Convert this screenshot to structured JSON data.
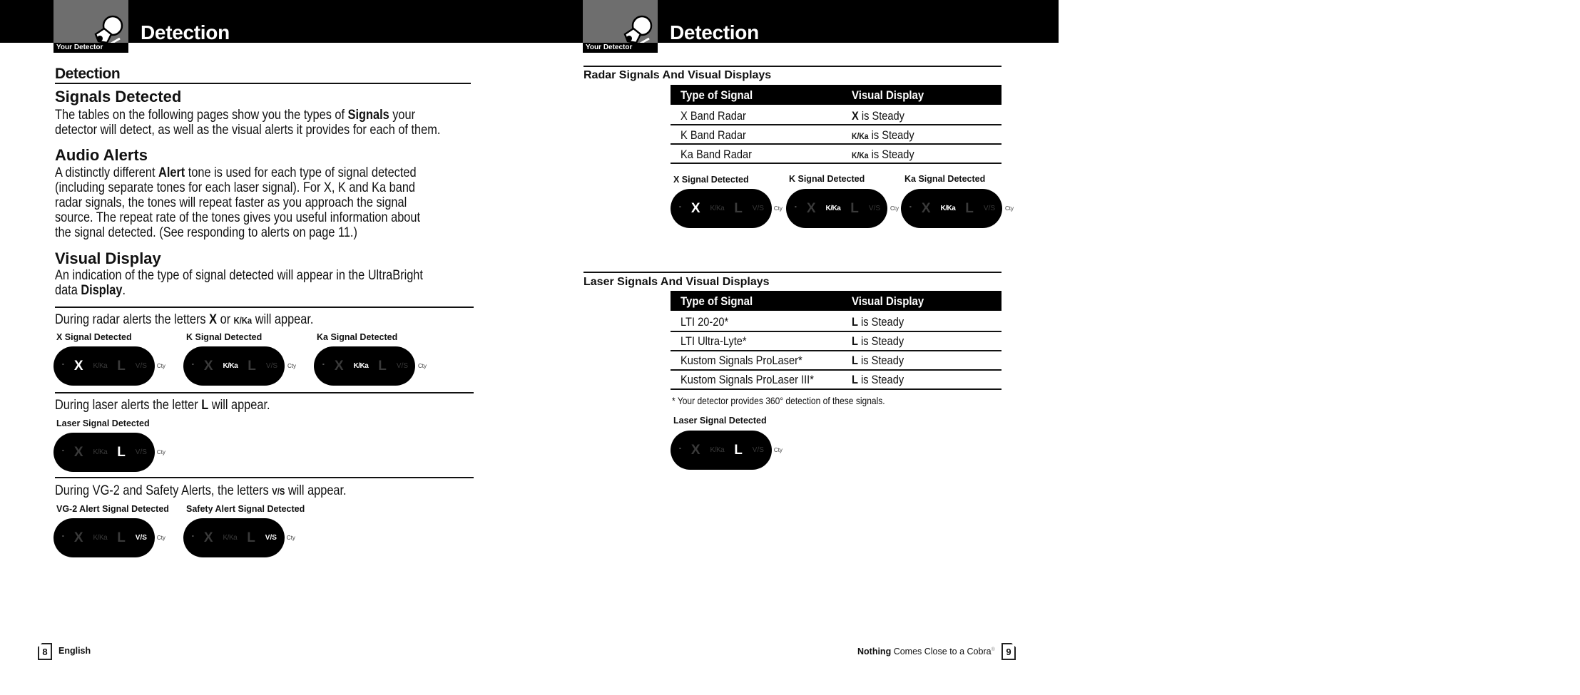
{
  "header": {
    "section_tag": "Your Detector",
    "title": "Detection",
    "icon": "radar-detector-icon"
  },
  "left_page": {
    "heading": "Detection",
    "signals": {
      "title": "Signals Detected",
      "lines": [
        {
          "pre": "The tables on the following pages show you the types of ",
          "bold": "Signals",
          "post": " your"
        },
        {
          "pre": "detector will detect, as well as the visual alerts it provides for each of them.",
          "bold": "",
          "post": ""
        }
      ]
    },
    "audio": {
      "title": "Audio Alerts",
      "lines": [
        {
          "pre": "A distinctly different ",
          "bold": "Alert",
          "post": " tone is used for each type of signal detected"
        },
        {
          "pre": "(including separate tones for each laser signal). For X, K and Ka band",
          "bold": "",
          "post": ""
        },
        {
          "pre": "radar signals, the tones will repeat faster as you approach the signal",
          "bold": "",
          "post": ""
        },
        {
          "pre": "source. The repeat rate of the tones gives you useful information about",
          "bold": "",
          "post": ""
        },
        {
          "pre": "the signal detected. (See responding to alerts on page 11.)",
          "bold": "",
          "post": ""
        }
      ]
    },
    "visual": {
      "title": "Visual Display",
      "lines": [
        {
          "pre": "An indication of the type of signal detected will appear in the UltraBright",
          "bold": "",
          "post": ""
        },
        {
          "pre": "data ",
          "bold": "Display",
          "post": "."
        }
      ]
    },
    "radar_section": {
      "lead_pre": "During radar alerts the letters ",
      "lead_bold1": "X",
      "lead_mid": " or ",
      "lead_bold2": "K/Ka",
      "lead_post": " will appear.",
      "displays": [
        {
          "label": "X Signal Detected",
          "active": "X"
        },
        {
          "label": "K Signal Detected",
          "active": "K/Ka"
        },
        {
          "label": "Ka Signal Detected",
          "active": "K/Ka"
        }
      ]
    },
    "laser_section": {
      "lead_pre": "During laser alerts the letter ",
      "lead_bold": "L",
      "lead_post": " will appear.",
      "displays": [
        {
          "label": "Laser Signal Detected",
          "active": "L"
        }
      ]
    },
    "vg2_section": {
      "lead_pre": "During VG-2 and Safety Alerts, the letters ",
      "lead_bold": "V/S",
      "lead_post": " will appear.",
      "displays": [
        {
          "label": "VG-2 Alert Signal Detected",
          "active": "V/S"
        },
        {
          "label": "Safety Alert Signal Detected",
          "active": "V/S"
        }
      ]
    },
    "footer": {
      "page_number": "8",
      "text": "English"
    }
  },
  "display_glyphs": {
    "dot": "°",
    "x": "X",
    "k": "K/Ka",
    "l": "L",
    "vs": "V/S",
    "cty": "Cty"
  },
  "right_page": {
    "radar_table": {
      "title": "Radar Signals And Visual Displays",
      "columns": [
        "Type of Signal",
        "Visual Display"
      ],
      "rows": [
        {
          "signal": "X Band Radar",
          "display_bold": "X",
          "display_rest": " is Steady"
        },
        {
          "signal": "K Band Radar",
          "display_bold": "K/Ka",
          "display_rest": " is Steady"
        },
        {
          "signal": "Ka Band Radar",
          "display_bold": "K/Ka",
          "display_rest": " is Steady"
        }
      ],
      "displays": [
        {
          "label": "X Signal Detected",
          "active": "X"
        },
        {
          "label": "K Signal Detected",
          "active": "K/Ka"
        },
        {
          "label": "Ka Signal Detected",
          "active": "K/Ka"
        }
      ]
    },
    "laser_table": {
      "title": "Laser Signals And Visual Displays",
      "columns": [
        "Type of Signal",
        "Visual Display"
      ],
      "rows": [
        {
          "signal": "LTI 20-20*",
          "display_bold": "L",
          "display_rest": " is Steady"
        },
        {
          "signal": "LTI Ultra-Lyte*",
          "display_bold": "L",
          "display_rest": " is Steady"
        },
        {
          "signal": "Kustom Signals ProLaser*",
          "display_bold": "L",
          "display_rest": " is Steady"
        },
        {
          "signal": "Kustom Signals ProLaser III*",
          "display_bold": "L",
          "display_rest": " is Steady"
        }
      ],
      "footnote": "* Your detector provides 360° detection of these signals.",
      "displays": [
        {
          "label": "Laser Signal Detected",
          "active": "L"
        }
      ]
    },
    "footer": {
      "tagline_bold": "Nothing",
      "tagline_rest": " Comes Close to a Cobra",
      "registered": "®",
      "page_number": "9"
    }
  },
  "colors": {
    "header_bg": "#000000",
    "icon_box_bg": "#6e6e6e",
    "display_bg": "#000000",
    "display_active": "#ffffff",
    "display_inactive": "#3a3a3a"
  }
}
